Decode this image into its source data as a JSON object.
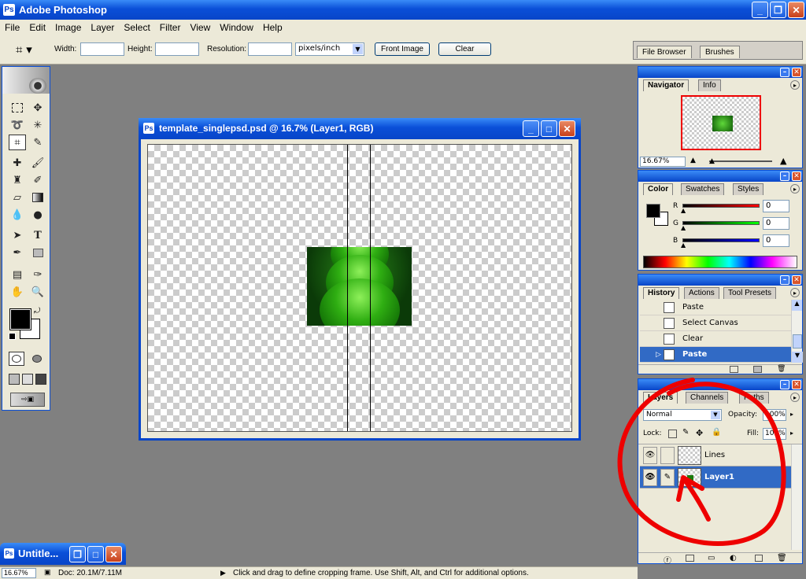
{
  "app": {
    "title": "Adobe Photoshop"
  },
  "menu": [
    "File",
    "Edit",
    "Image",
    "Layer",
    "Select",
    "Filter",
    "View",
    "Window",
    "Help"
  ],
  "options": {
    "width_label": "Width:",
    "height_label": "Height:",
    "resolution_label": "Resolution:",
    "units": "pixels/inch",
    "front_image": "Front Image",
    "clear": "Clear"
  },
  "palette_well": [
    "File Browser",
    "Brushes"
  ],
  "document": {
    "title": "template_singlepsd.psd @ 16.7% (Layer1, RGB)"
  },
  "minimized_doc": {
    "title": "Untitle..."
  },
  "navigator": {
    "tabs": [
      "Navigator",
      "Info"
    ],
    "zoom": "16.67%"
  },
  "color": {
    "tabs": [
      "Color",
      "Swatches",
      "Styles"
    ],
    "channels": [
      {
        "label": "R",
        "value": "0"
      },
      {
        "label": "G",
        "value": "0"
      },
      {
        "label": "B",
        "value": "0"
      }
    ]
  },
  "history": {
    "tabs": [
      "History",
      "Actions",
      "Tool Presets"
    ],
    "items": [
      "Paste",
      "Select Canvas",
      "Clear",
      "Paste"
    ]
  },
  "layers": {
    "tabs": [
      "Layers",
      "Channels",
      "Paths"
    ],
    "blend_mode": "Normal",
    "opacity_label": "Opacity:",
    "opacity": "100%",
    "lock_label": "Lock:",
    "fill_label": "Fill:",
    "fill": "100%",
    "items": [
      {
        "name": "Lines"
      },
      {
        "name": "Layer1"
      }
    ]
  },
  "status": {
    "zoom": "16.67%",
    "doc": "Doc: 20.1M/7.11M",
    "hint": "Click and drag to define cropping frame. Use Shift, Alt, and Ctrl for additional options."
  }
}
